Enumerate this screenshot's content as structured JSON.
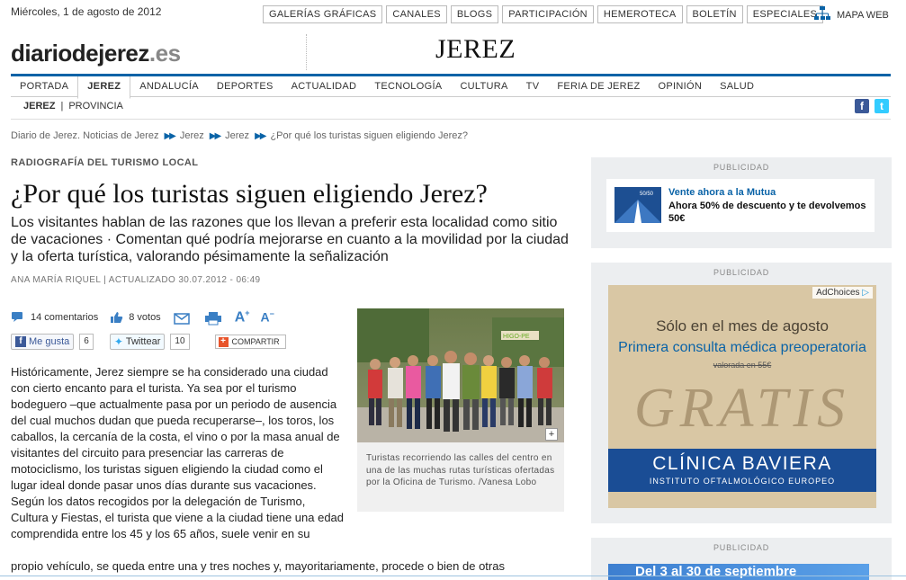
{
  "topbar": {
    "date": "Miércoles, 1 de agosto de 2012",
    "nav": [
      "GALERÍAS GRÁFICAS",
      "CANALES",
      "BLOGS",
      "PARTICIPACIÓN",
      "HEMEROTECA",
      "BOLETÍN",
      "ESPECIALES"
    ],
    "sitemap": "MAPA WEB"
  },
  "masthead": {
    "logo_main": "diariodejerez",
    "logo_tld": ".es",
    "section": "JEREZ"
  },
  "mainnav": {
    "items": [
      "PORTADA",
      "JEREZ",
      "ANDALUCÍA",
      "DEPORTES",
      "ACTUALIDAD",
      "TECNOLOGÍA",
      "CULTURA",
      "TV",
      "FERIA DE JEREZ",
      "OPINIÓN",
      "SALUD"
    ],
    "active": "JEREZ"
  },
  "subnav": {
    "items": [
      "JEREZ",
      "PROVINCIA"
    ],
    "separator": "|"
  },
  "breadcrumb": [
    "Diario de Jerez. Noticias de Jerez",
    "Jerez",
    "Jerez",
    "¿Por qué los turistas siguen eligiendo Jerez?"
  ],
  "article": {
    "kicker": "RADIOGRAFÍA DEL TURISMO LOCAL",
    "headline": "¿Por qué los turistas siguen eligiendo Jerez?",
    "subhead": "Los visitantes hablan de las razones que los llevan a preferir esta localidad como sitio de vacaciones · Comentan qué podría mejorarse en cuanto a la movilidad por la ciudad y la oferta turística, valorando pésimamente la señalización",
    "byline": "ANA MARÍA RIQUEL | ACTUALIZADO 30.07.2012 - 06:49",
    "comments": "14 comentarios",
    "votes": "8 votos",
    "font_larger": "A",
    "font_smaller": "A",
    "like_label": "Me gusta",
    "like_count": "6",
    "tweet_label": "Twittear",
    "tweet_count": "10",
    "share_label": "COMPARTIR",
    "photo_caption": "Turistas recorriendo las calles del centro en una de las muchas rutas turísticas ofertadas por la Oficina de Turismo. /Vanesa Lobo",
    "photo_expand": "+",
    "photo_sign": "HIGO-PE",
    "body": " Históricamente, Jerez siempre se ha considerado una ciudad con cierto encanto para el turista. Ya sea por el turismo bodeguero –que actualmente pasa por un periodo de ausencia del cual muchos dudan que pueda recuperarse–, los toros, los caballos, la cercanía de la costa, el vino o por la masa anual de visitantes del circuito para presenciar las carreras de motociclismo, los turistas siguen eligiendo la ciudad como el lugar ideal donde pasar unos días durante sus vacaciones. Según los datos recogidos por la delegación de Turismo, Cultura y Fiestas, el turista que viene a la ciudad tiene una edad comprendida entre los 45 y los 65 años, suele venir en su",
    "body_tail": "propio vehículo, se queda entre una y tres noches y, mayoritariamente, procede o bien de otras"
  },
  "sidebar": {
    "ad_label": "PUBLICIDAD",
    "ad1": {
      "title": "Vente ahora a la Mutua",
      "desc": "Ahora 50% de descuento y te devolvemos 50€",
      "img_text": "50/50"
    },
    "ad2": {
      "adchoices": "AdChoices",
      "line1": "Sólo en el mes de agosto",
      "line2": "Primera consulta médica preoperatoria",
      "line3": "valorada en 55€",
      "sand": "GRATIS",
      "brand": "CLÍNICA BAVIERA",
      "sub": "INSTITUTO OFTALMOLÓGICO EUROPEO"
    },
    "ad3": {
      "text": "Del 3 al 30 de septiembre"
    }
  },
  "colors": {
    "accent": "#0a63a7",
    "sidebar_bg": "#eceef0",
    "ad_blue": "#1a4d95"
  }
}
